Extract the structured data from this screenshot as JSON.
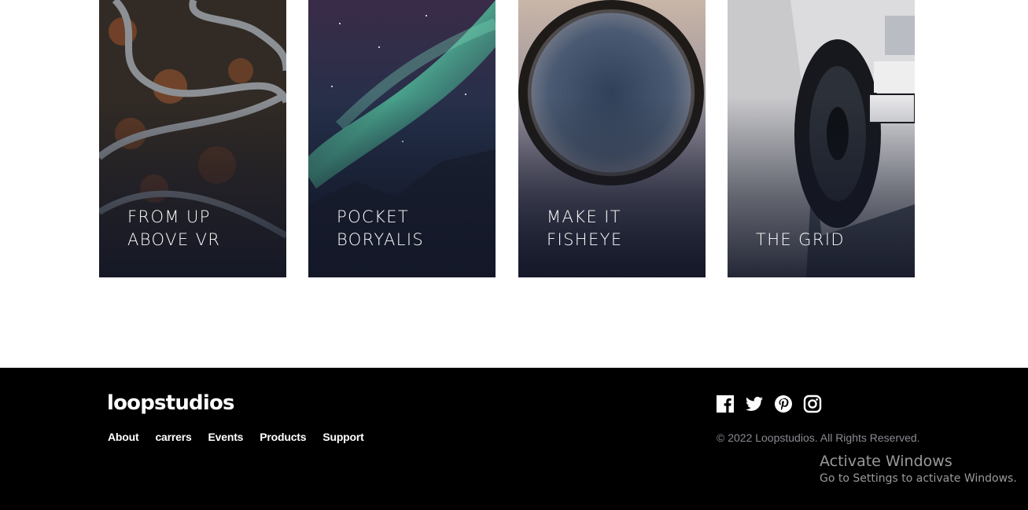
{
  "cards": [
    {
      "line1": "FROM UP",
      "line2": "ABOVE VR",
      "image": "aerial-winding-road"
    },
    {
      "line1": "POCKET",
      "line2": "BORYALIS",
      "image": "aurora-borealis"
    },
    {
      "line1": "MAKE IT",
      "line2": "FISHEYE",
      "image": "fisheye-planet"
    },
    {
      "line1": "",
      "line2": "THE GRID",
      "image": "race-car-wheel"
    }
  ],
  "footer": {
    "logo": "loopstudios",
    "nav": [
      "About",
      "carrers",
      "Events",
      "Products",
      "Support"
    ],
    "socials": [
      "facebook-icon",
      "twitter-icon",
      "pinterest-icon",
      "instagram-icon"
    ],
    "copyright": "© 2022 Loopstudios. All Rights Reserved."
  },
  "overlay": {
    "title": "Activate Windows",
    "subtitle": "Go to Settings to activate Windows."
  },
  "colors": {
    "footer_bg": "#000000",
    "card_text": "#ffffff",
    "copyright_text": "#8a8a93"
  }
}
